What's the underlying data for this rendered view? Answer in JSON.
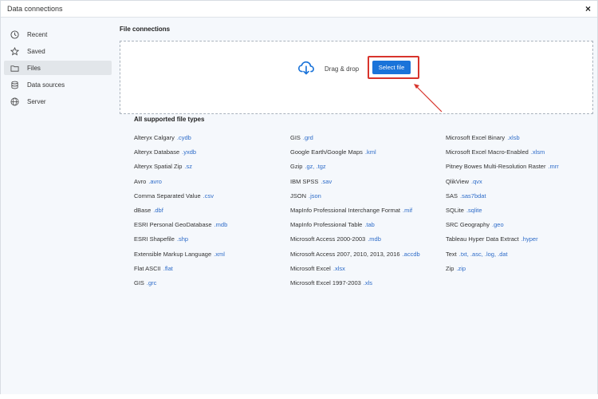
{
  "window": {
    "title": "Data connections",
    "close_label": "×"
  },
  "sidebar": {
    "items": [
      {
        "label": "Recent",
        "icon": "clock-icon"
      },
      {
        "label": "Saved",
        "icon": "star-icon"
      },
      {
        "label": "Files",
        "icon": "folder-icon",
        "active": true
      },
      {
        "label": "Data sources",
        "icon": "database-icon"
      },
      {
        "label": "Server",
        "icon": "globe-icon"
      }
    ]
  },
  "main": {
    "heading": "File connections",
    "dropzone": {
      "text": "Drag & drop",
      "button_label": "Select file"
    },
    "types_heading": "All supported file types",
    "columns": [
      [
        {
          "name": "Alteryx Calgary",
          "ext": ".cydb"
        },
        {
          "name": "Alteryx Database",
          "ext": ".yxdb"
        },
        {
          "name": "Alteryx Spatial Zip",
          "ext": ".sz"
        },
        {
          "name": "Avro",
          "ext": ".avro"
        },
        {
          "name": "Comma Separated Value",
          "ext": ".csv"
        },
        {
          "name": "dBase",
          "ext": ".dbf"
        },
        {
          "name": "ESRI Personal GeoDatabase",
          "ext": ".mdb"
        },
        {
          "name": "ESRI Shapefile",
          "ext": ".shp"
        },
        {
          "name": "Extensible Markup Language",
          "ext": ".xml"
        },
        {
          "name": "Flat ASCII",
          "ext": ".flat"
        },
        {
          "name": "GIS",
          "ext": ".grc"
        }
      ],
      [
        {
          "name": "GIS",
          "ext": ".grd"
        },
        {
          "name": "Google Earth/Google Maps",
          "ext": ".kml"
        },
        {
          "name": "Gzip",
          "ext": ".gz, .tgz"
        },
        {
          "name": "IBM SPSS",
          "ext": ".sav"
        },
        {
          "name": "JSON",
          "ext": ".json"
        },
        {
          "name": "MapInfo Professional Interchange Format",
          "ext": ".mif"
        },
        {
          "name": "MapInfo Professional Table",
          "ext": ".tab"
        },
        {
          "name": "Microsoft Access 2000-2003",
          "ext": ".mdb"
        },
        {
          "name": "Microsoft Access 2007, 2010, 2013, 2016",
          "ext": ".accdb"
        },
        {
          "name": "Microsoft Excel",
          "ext": ".xlsx"
        },
        {
          "name": "Microsoft Excel 1997-2003",
          "ext": ".xls"
        }
      ],
      [
        {
          "name": "Microsoft Excel Binary",
          "ext": ".xlsb"
        },
        {
          "name": "Microsoft Excel Macro-Enabled",
          "ext": ".xlsm"
        },
        {
          "name": "Pitney Bowes Multi-Resolution Raster",
          "ext": ".mrr"
        },
        {
          "name": "QlikView",
          "ext": ".qvx"
        },
        {
          "name": "SAS",
          "ext": ".sas7bdat"
        },
        {
          "name": "SQLite",
          "ext": ".sqlite"
        },
        {
          "name": "SRC Geography",
          "ext": ".geo"
        },
        {
          "name": "Tableau Hyper Data Extract",
          "ext": ".hyper"
        },
        {
          "name": "Text",
          "ext": ".txt, .asc, .log, .dat"
        },
        {
          "name": "Zip",
          "ext": ".zip"
        }
      ]
    ]
  },
  "colors": {
    "accent": "#1a73d9",
    "extension": "#2f6dc9",
    "highlight": "#d8342c"
  }
}
